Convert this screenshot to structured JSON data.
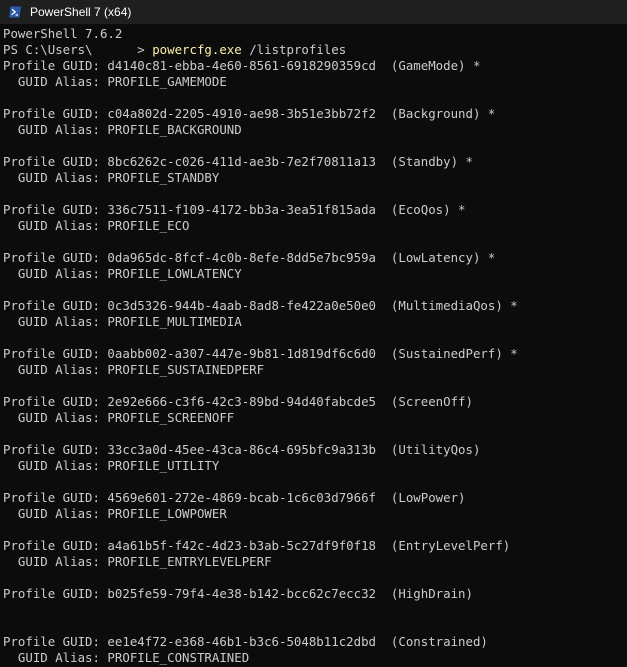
{
  "window": {
    "title": "PowerShell 7 (x64)"
  },
  "console": {
    "banner": "PowerShell 7.6.2",
    "prompt": "PS C:\\Users\\      > ",
    "command": "powercfg.exe",
    "argument": " /listprofiles",
    "profiles": [
      {
        "guid_line": "Profile GUID: d4140c81-ebba-4e60-8561-6918290359cd  (GameMode) *",
        "alias_line": "  GUID Alias: PROFILE_GAMEMODE"
      },
      {
        "guid_line": "Profile GUID: c04a802d-2205-4910-ae98-3b51e3bb72f2  (Background) *",
        "alias_line": "  GUID Alias: PROFILE_BACKGROUND"
      },
      {
        "guid_line": "Profile GUID: 8bc6262c-c026-411d-ae3b-7e2f70811a13  (Standby) *",
        "alias_line": "  GUID Alias: PROFILE_STANDBY"
      },
      {
        "guid_line": "Profile GUID: 336c7511-f109-4172-bb3a-3ea51f815ada  (EcoQos) *",
        "alias_line": "  GUID Alias: PROFILE_ECO"
      },
      {
        "guid_line": "Profile GUID: 0da965dc-8fcf-4c0b-8efe-8dd5e7bc959a  (LowLatency) *",
        "alias_line": "  GUID Alias: PROFILE_LOWLATENCY"
      },
      {
        "guid_line": "Profile GUID: 0c3d5326-944b-4aab-8ad8-fe422a0e50e0  (MultimediaQos) *",
        "alias_line": "  GUID Alias: PROFILE_MULTIMEDIA"
      },
      {
        "guid_line": "Profile GUID: 0aabb002-a307-447e-9b81-1d819df6c6d0  (SustainedPerf) *",
        "alias_line": "  GUID Alias: PROFILE_SUSTAINEDPERF"
      },
      {
        "guid_line": "Profile GUID: 2e92e666-c3f6-42c3-89bd-94d40fabcde5  (ScreenOff)",
        "alias_line": "  GUID Alias: PROFILE_SCREENOFF"
      },
      {
        "guid_line": "Profile GUID: 33cc3a0d-45ee-43ca-86c4-695bfc9a313b  (UtilityQos)",
        "alias_line": "  GUID Alias: PROFILE_UTILITY"
      },
      {
        "guid_line": "Profile GUID: 4569e601-272e-4869-bcab-1c6c03d7966f  (LowPower)",
        "alias_line": "  GUID Alias: PROFILE_LOWPOWER"
      },
      {
        "guid_line": "Profile GUID: a4a61b5f-f42c-4d23-b3ab-5c27df9f0f18  (EntryLevelPerf)",
        "alias_line": "  GUID Alias: PROFILE_ENTRYLEVELPERF"
      },
      {
        "guid_line": "Profile GUID: b025fe59-79f4-4e38-b142-bcc62c7ecc32  (HighDrain)",
        "alias_line": ""
      },
      {
        "guid_line": "Profile GUID: ee1e4f72-e368-46b1-b3c6-5048b11c2dbd  (Constrained)",
        "alias_line": "  GUID Alias: PROFILE_CONSTRAINED"
      }
    ]
  },
  "colors": {
    "background": "#0c0c0c",
    "titlebar": "#1f1f1f",
    "text": "#cccccc",
    "command": "#f9f1a5",
    "icon": "#2b5aa8"
  },
  "icons": {
    "app": "powershell-icon"
  }
}
